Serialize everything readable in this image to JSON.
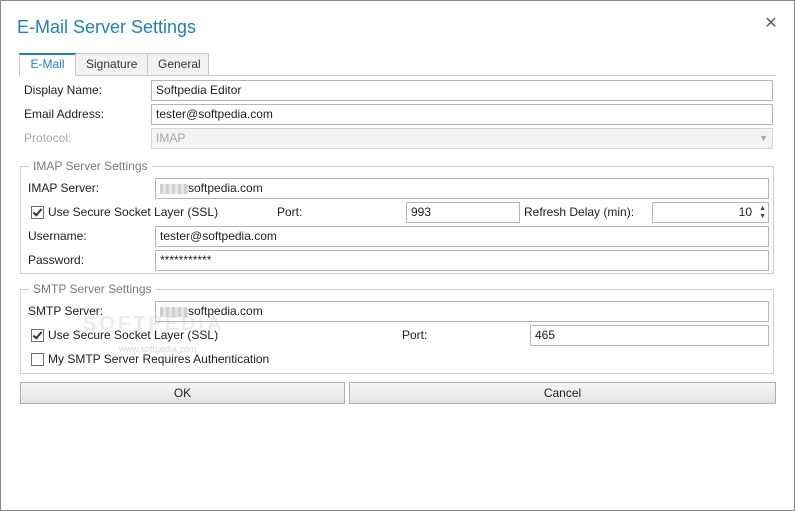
{
  "window": {
    "title": "E-Mail Server Settings",
    "close_glyph": "✕"
  },
  "tabs": [
    {
      "label": "E-Mail",
      "active": true
    },
    {
      "label": "Signature",
      "active": false
    },
    {
      "label": "General",
      "active": false
    }
  ],
  "general": {
    "display_name_label": "Display Name:",
    "display_name_value": "Softpedia Editor",
    "email_label": "Email Address:",
    "email_value": "tester@softpedia.com",
    "protocol_label": "Protocol:",
    "protocol_value": "IMAP"
  },
  "imap": {
    "group_title": "IMAP Server Settings",
    "server_label": "IMAP Server:",
    "server_value": "softpedia.com",
    "ssl_label": "Use Secure Socket Layer (SSL)",
    "ssl_checked": true,
    "port_label": "Port:",
    "port_value": "993",
    "refresh_label": "Refresh Delay (min):",
    "refresh_value": "10",
    "username_label": "Username:",
    "username_value": "tester@softpedia.com",
    "password_label": "Password:",
    "password_value": "***********"
  },
  "smtp": {
    "group_title": "SMTP Server Settings",
    "server_label": "SMTP Server:",
    "server_value": "softpedia.com",
    "ssl_label": "Use Secure Socket Layer (SSL)",
    "ssl_checked": true,
    "port_label": "Port:",
    "port_value": "465",
    "auth_label": "My SMTP Server Requires Authentication",
    "auth_checked": false
  },
  "buttons": {
    "ok": "OK",
    "cancel": "Cancel"
  },
  "watermark": {
    "main": "SOFTPEDIA",
    "sub": "www.softpedia.com"
  },
  "colors": {
    "accent": "#1e7fc1"
  }
}
